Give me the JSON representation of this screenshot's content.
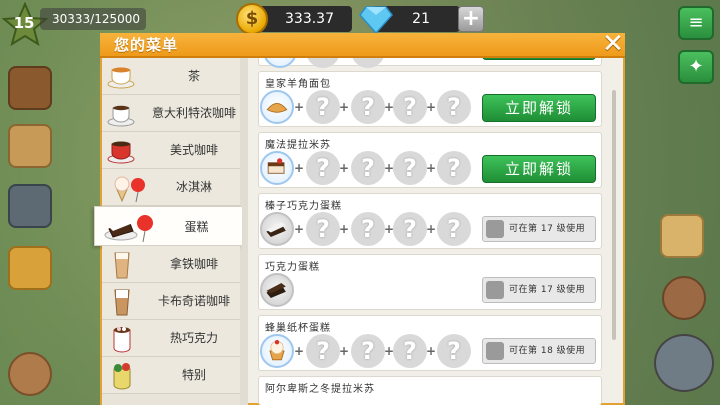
{
  "hud": {
    "level": "15",
    "xp": "30333/125000",
    "coins": "333.37",
    "gems": "21",
    "plus": "+"
  },
  "panel": {
    "title": "您的菜单",
    "close": "✕"
  },
  "categories": [
    {
      "label": "茶"
    },
    {
      "label": "意大利特浓咖啡"
    },
    {
      "label": "美式咖啡"
    },
    {
      "label": "冰淇淋"
    },
    {
      "label": "蛋糕"
    },
    {
      "label": "拿铁咖啡"
    },
    {
      "label": "卡布奇诺咖啡"
    },
    {
      "label": "热巧克力"
    },
    {
      "label": "特别"
    }
  ],
  "recipes": [
    {
      "name": "皇家羊角面包",
      "action": "立即解锁"
    },
    {
      "name": "魔法提拉米苏",
      "action": "立即解锁"
    },
    {
      "name": "榛子巧克力蛋糕",
      "action": "可在第 17 级使用"
    },
    {
      "name": "巧克力蛋糕",
      "action": "可在第 17 级使用"
    },
    {
      "name": "蜂巢纸杯蛋糕",
      "action": "可在第 18 级使用"
    },
    {
      "name": "阿尔卑斯之冬提拉米苏",
      "action": ""
    }
  ],
  "placeholders": {
    "question": "?",
    "plus": "+"
  },
  "colors": {
    "accent": "#EE9A1A",
    "unlock": "#2AA845",
    "panel": "#F1EFE8"
  },
  "icons": [
    "star-icon",
    "coin-icon",
    "gem-icon",
    "plus-icon",
    "close-icon",
    "lock-icon",
    "menu-icon",
    "gamepad-icon"
  ]
}
